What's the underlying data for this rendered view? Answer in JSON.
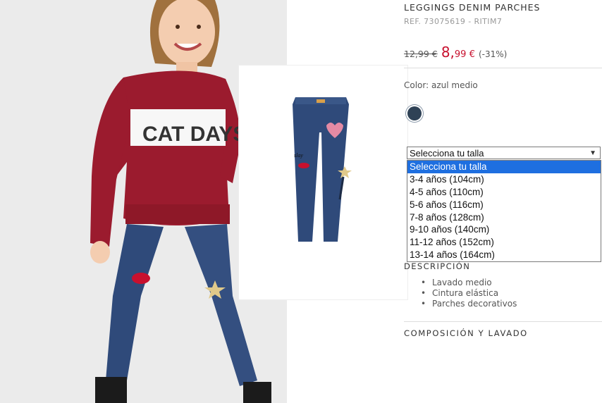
{
  "product": {
    "title": "LEGGINGS DENIM PARCHES",
    "ref": "REF. 73075619 - RITIM7",
    "price_old": "12,99 €",
    "price_new_int": "8,",
    "price_new_dec": "99 €",
    "discount": "(-31%)"
  },
  "color": {
    "label": "Color: azul medio",
    "swatch_hex": "#2f4256"
  },
  "size_select": {
    "selected": "Selecciona tu talla",
    "options": [
      "Selecciona tu talla",
      "3-4 años (104cm)",
      "4-5 años (110cm)",
      "5-6 años (116cm)",
      "7-8 años (128cm)",
      "9-10 años (140cm)",
      "11-12 años (152cm)",
      "13-14 años (164cm)"
    ]
  },
  "description": {
    "heading": "DESCRIPCIÓN",
    "items": [
      "Lavado medio",
      "Cintura elástica",
      "Parches decorativos"
    ]
  },
  "composition": {
    "heading": "COMPOSICIÓN Y LAVADO"
  },
  "photo": {
    "sweater_text": "CAT DAYS"
  },
  "colors": {
    "accent_red": "#c8102e",
    "select_highlight": "#1e6fe0"
  }
}
